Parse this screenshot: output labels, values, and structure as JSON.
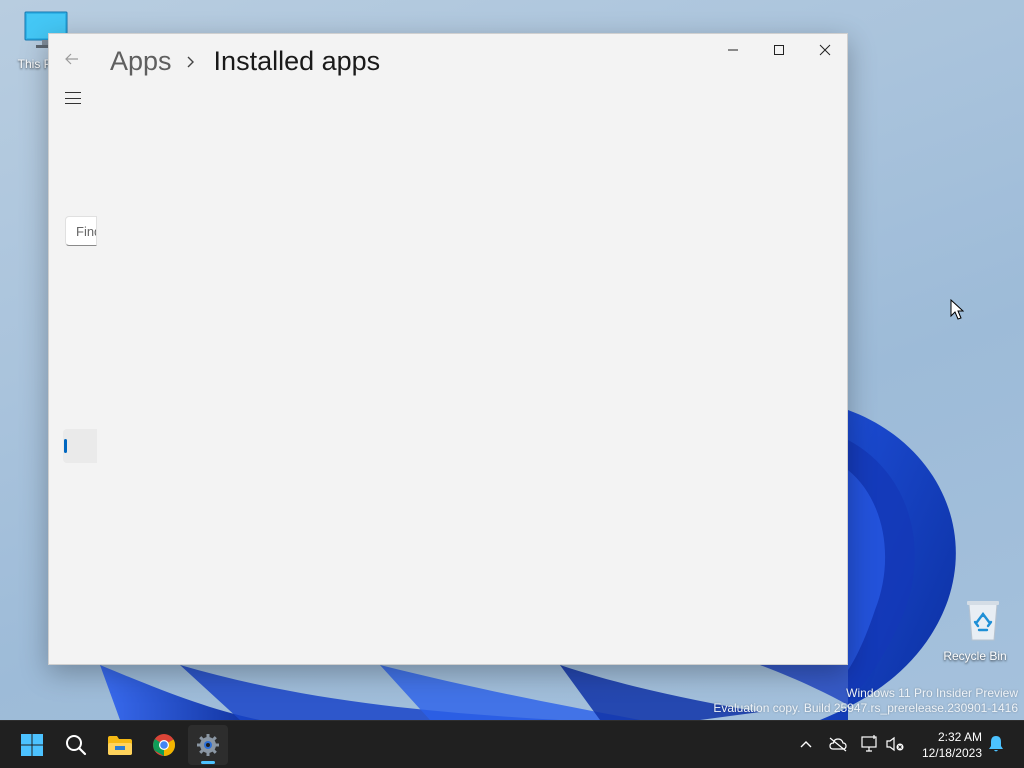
{
  "desktop": {
    "icons": [
      {
        "label": "This PC"
      },
      {
        "label": "Recycle Bin"
      }
    ],
    "watermark": {
      "line1": "Windows 11 Pro Insider Preview",
      "line2": "Evaluation copy. Build 25947.rs_prerelease.230901-1416"
    }
  },
  "window": {
    "breadcrumb": {
      "parent": "Apps",
      "current": "Installed apps"
    },
    "search": {
      "placeholder": "Find"
    },
    "controls": {
      "minimize": "minimize-icon",
      "maximize": "maximize-icon",
      "close": "close-icon"
    }
  },
  "taskbar": {
    "clock": {
      "time": "2:32 AM",
      "date": "12/18/2023"
    },
    "colors": {
      "background": "#202020",
      "accent": "#0067c0",
      "running_indicator": "#4cc2ff"
    }
  }
}
